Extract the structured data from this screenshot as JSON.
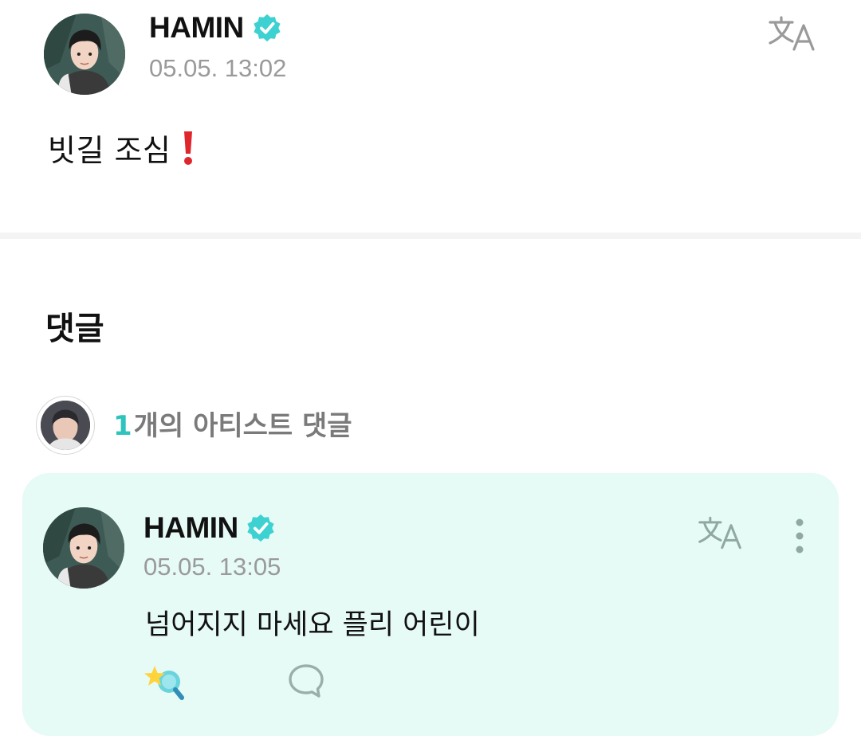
{
  "post": {
    "author": "HAMIN",
    "verified_icon": "verified-badge-icon",
    "timestamp": "05.05. 13:02",
    "translate_icon": "translate-icon",
    "text": "빗길 조심",
    "emoji_icon": "red-exclamation-icon"
  },
  "comments": {
    "heading": "댓글",
    "artist_summary": {
      "count": "1",
      "label": "개의 아티스트 댓글"
    },
    "items": [
      {
        "author": "HAMIN",
        "timestamp": "05.05. 13:05",
        "text": "넘어지지 마세요 플리 어린이",
        "icons": [
          "translate-icon",
          "more-vert-icon",
          "reaction-icon",
          "reply-bubble-icon"
        ]
      }
    ]
  },
  "colors": {
    "accent": "#2ec4bd",
    "verified": "#3dd1d1",
    "card_background": "#e6faf6",
    "muted_text": "#9a9a9a"
  }
}
